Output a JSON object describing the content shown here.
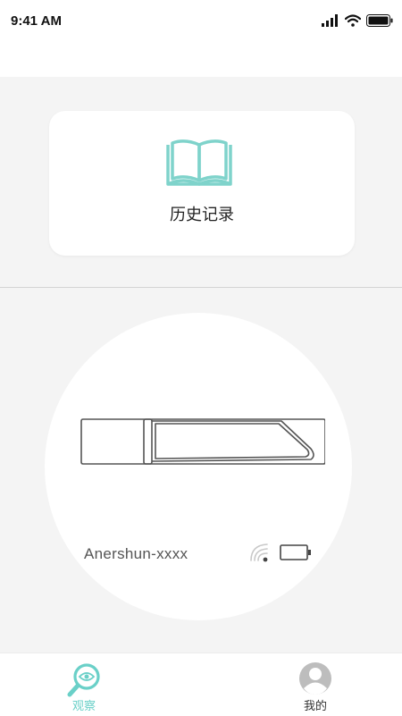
{
  "status_bar": {
    "time": "9:41 AM"
  },
  "history": {
    "label": "历史记录",
    "icon": "open-book-icon"
  },
  "device": {
    "name": "Anershun-xxxx",
    "signal_icon": "wifi-signal-icon",
    "battery_icon": "battery-icon"
  },
  "tabs": [
    {
      "label": "观察",
      "icon": "magnifier-eye-icon",
      "active": true
    },
    {
      "label": "我的",
      "icon": "user-avatar-icon",
      "active": false
    }
  ],
  "colors": {
    "accent": "#6ad0c8",
    "background": "#f4f4f4",
    "card": "#ffffff"
  }
}
